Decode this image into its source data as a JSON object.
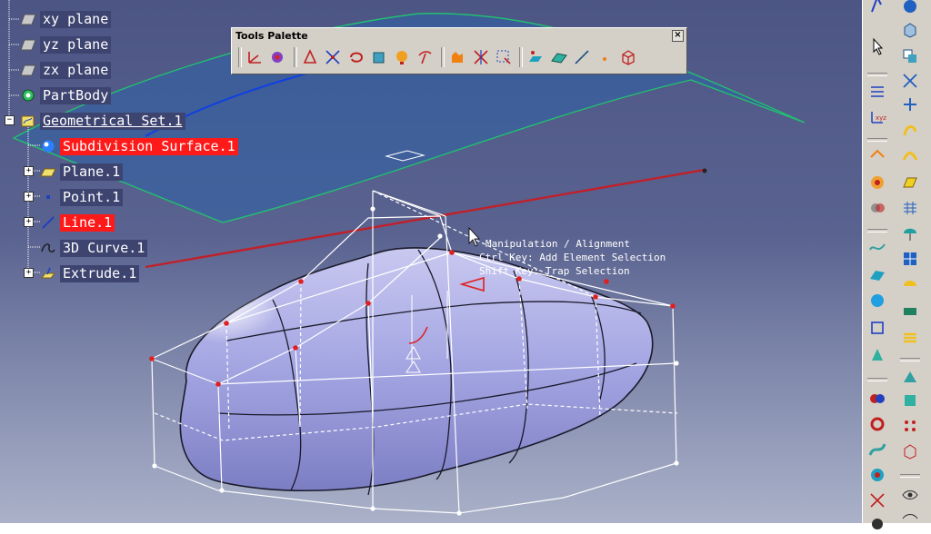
{
  "tree": {
    "items": [
      {
        "label": "xy plane",
        "icon": "plane-icon"
      },
      {
        "label": "yz plane",
        "icon": "plane-icon"
      },
      {
        "label": "zx plane",
        "icon": "plane-icon"
      },
      {
        "label": "PartBody",
        "icon": "gear-icon"
      },
      {
        "label": "Geometrical Set.1",
        "icon": "geometrical-set-icon"
      },
      {
        "label": "Subdivision Surface.1",
        "icon": "subdivision-surface-icon"
      },
      {
        "label": "Plane.1",
        "icon": "plane-icon"
      },
      {
        "label": "Point.1",
        "icon": "point-icon"
      },
      {
        "label": "Line.1",
        "icon": "line-icon"
      },
      {
        "label": "3D Curve.1",
        "icon": "curve-icon"
      },
      {
        "label": "Extrude.1",
        "icon": "extrude-icon"
      }
    ]
  },
  "tooltip": {
    "line1": "Manipulation / Alignment",
    "line2": "Ctrl Key: Add Element Selection",
    "line3": "Shift Key: Trap Selection"
  },
  "palette": {
    "title": "Tools Palette",
    "close": "×"
  },
  "colors": {
    "background": "#5a6390",
    "surface": "#a4a8e0",
    "selection": "#ff1a1a",
    "line": "#c0202a",
    "plane_edge": "#22c070",
    "toolbar": "#d4d0c8"
  }
}
